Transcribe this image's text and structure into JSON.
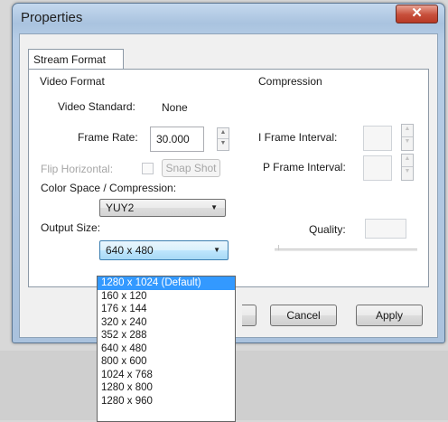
{
  "window": {
    "title": "Properties",
    "close_glyph": "✕"
  },
  "tabs": [
    {
      "label": "Stream Format"
    }
  ],
  "video_format": {
    "heading": "Video Format",
    "video_standard": {
      "label": "Video Standard:",
      "value": "None"
    },
    "frame_rate": {
      "label": "Frame Rate:",
      "value": "30.000"
    },
    "flip_horizontal": {
      "label": "Flip Horizontal:",
      "checked": false
    },
    "snap_shot_label": "Snap Shot",
    "color_space": {
      "label": "Color Space / Compression:",
      "value": "YUY2"
    },
    "output_size": {
      "label": "Output Size:",
      "value": "640 x 480",
      "options": [
        "1280 x 1024 (Default)",
        "160 x 120",
        "176 x 144",
        "320 x 240",
        "352 x 288",
        "640 x 480",
        "800 x 600",
        "1024 x 768",
        "1280 x 800",
        "1280 x 960"
      ],
      "highlighted": "1280 x 1024 (Default)"
    }
  },
  "compression": {
    "heading": "Compression",
    "i_frame_interval": {
      "label": "I Frame Interval:",
      "value": ""
    },
    "p_frame_interval": {
      "label": "P Frame Interval:",
      "value": ""
    },
    "quality": {
      "label": "Quality:",
      "value": ""
    }
  },
  "buttons": {
    "cancel": "Cancel",
    "apply": "Apply"
  },
  "colors": {
    "selection": "#3399ff",
    "close_button": "#c74e3a",
    "window_frame": "#a9c3df"
  },
  "icons": {
    "close": "close-icon",
    "spin_up": "spin-up-icon",
    "spin_down": "spin-down-icon",
    "dropdown": "chevron-down-icon"
  }
}
